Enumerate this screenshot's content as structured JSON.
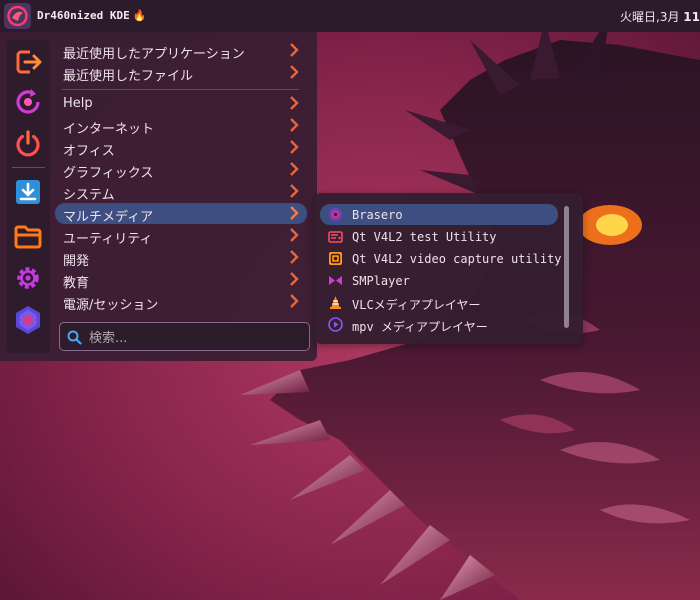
{
  "panel": {
    "distro_name": "Dr460nized KDE",
    "flame_icon": "🔥",
    "clock_date": "火曜日,3月",
    "clock_day": "11"
  },
  "sidebar": {
    "items": [
      {
        "name": "logout",
        "icon": "logout-icon",
        "color": "#ff6a3a"
      },
      {
        "name": "restart",
        "icon": "restart-icon",
        "color": "#d23ad6"
      },
      {
        "name": "shutdown",
        "icon": "power-icon",
        "color": "#ff4f4f"
      },
      {
        "name": "downloads",
        "icon": "download-icon",
        "color": "#3aa6f0"
      },
      {
        "name": "files",
        "icon": "folder-icon",
        "color": "#ff7a1a"
      },
      {
        "name": "settings",
        "icon": "gear-icon",
        "color": "#c43ae0"
      },
      {
        "name": "app-center",
        "icon": "hexagon-icon",
        "color": "#5a46d8"
      }
    ]
  },
  "menu": {
    "recent_apps": "最近使用したアプリケーション",
    "recent_files": "最近使用したファイル",
    "categories": [
      "Help",
      "インターネット",
      "オフィス",
      "グラフィックス",
      "システム",
      "マルチメディア",
      "ユーティリティ",
      "開発",
      "教育",
      "電源/セッション"
    ],
    "active_category": "マルチメディア"
  },
  "search": {
    "placeholder": "検索..."
  },
  "submenu": {
    "items": [
      {
        "label": "Brasero",
        "icon": "brasero-icon"
      },
      {
        "label": "Qt V4L2 test Utility",
        "icon": "v4l2-test-icon"
      },
      {
        "label": "Qt V4L2 video capture utility",
        "icon": "v4l2-capture-icon"
      },
      {
        "label": "SMPlayer",
        "icon": "smplayer-icon"
      },
      {
        "label": "VLCメディアプレイヤー",
        "icon": "vlc-icon"
      },
      {
        "label": "mpv メディアプレイヤー",
        "icon": "mpv-icon"
      }
    ]
  },
  "colors": {
    "accent": "#3c4f80",
    "panel": "#2b1b2c",
    "menu_bg": "#3a1e34",
    "chevron": "#e8663a"
  }
}
